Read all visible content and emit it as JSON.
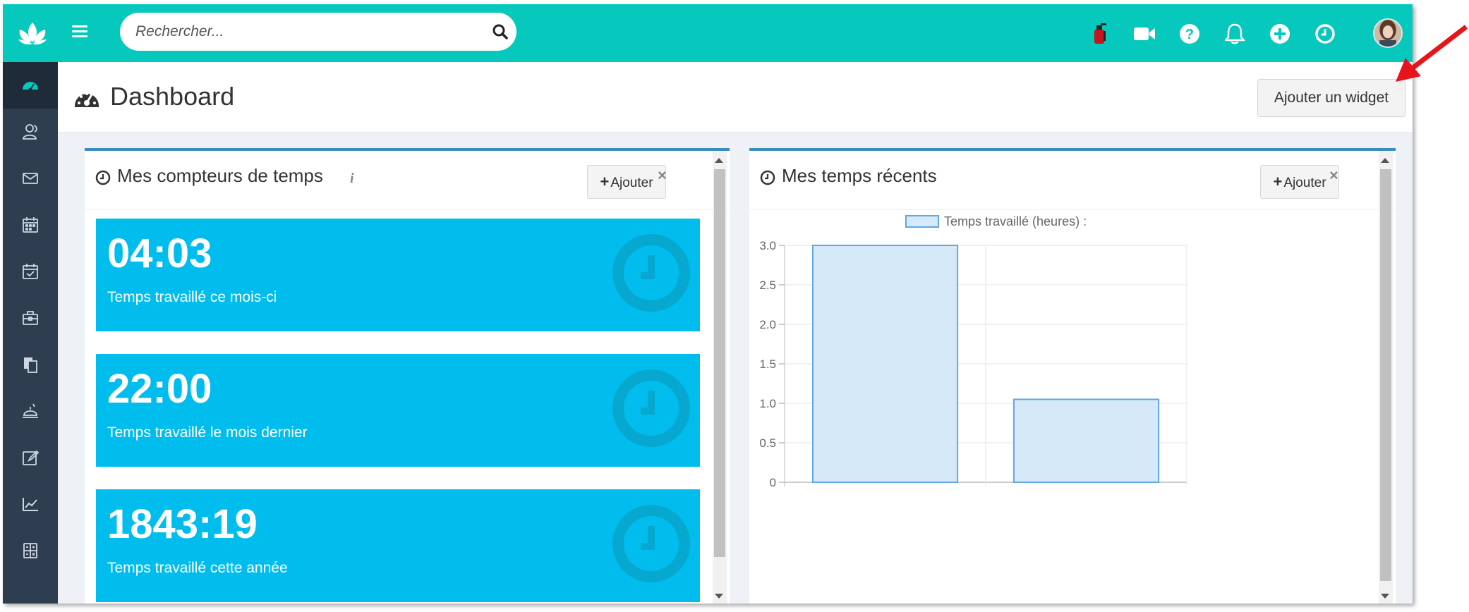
{
  "search": {
    "placeholder": "Rechercher..."
  },
  "header": {
    "title": "Dashboard",
    "add_widget_label": "Ajouter un widget"
  },
  "topbar": {
    "icons": [
      "fire-extinguisher-icon",
      "video-camera-icon",
      "help-icon",
      "bell-icon",
      "plus-circle-icon",
      "clock-icon"
    ]
  },
  "sidebar": {
    "items": [
      "dashboard-icon",
      "users-icon",
      "mail-icon",
      "calendar-icon",
      "calendar-check-icon",
      "briefcase-icon",
      "documents-icon",
      "service-bell-icon",
      "edit-icon",
      "chart-line-icon",
      "calculator-icon"
    ]
  },
  "counters_panel": {
    "title": "Mes compteurs de temps",
    "info": "i",
    "add_label": "Ajouter",
    "close": "×",
    "counters": [
      {
        "value": "04:03",
        "label": "Temps travaillé ce mois-ci"
      },
      {
        "value": "22:00",
        "label": "Temps travaillé le mois dernier"
      },
      {
        "value": "1843:19",
        "label": "Temps travaillé cette année"
      }
    ]
  },
  "recent_panel": {
    "title": "Mes temps récents",
    "add_label": "Ajouter",
    "close": "×"
  },
  "colors": {
    "teal": "#06c8bc",
    "sidebar": "#2e3d4f",
    "counter": "#00bded",
    "bar_fill": "#d6e9f8",
    "bar_stroke": "#5fa8e0"
  },
  "chart_data": {
    "type": "bar",
    "categories": [
      "",
      ""
    ],
    "series": [
      {
        "name": "Temps travaillé (heures) :",
        "values": [
          3.0,
          1.05
        ]
      }
    ],
    "yticks": [
      "0",
      "0.5",
      "1.0",
      "1.5",
      "2.0",
      "2.5",
      "3.0"
    ],
    "ylim": [
      0,
      3.0
    ],
    "grid": true,
    "legend": "top-center"
  }
}
